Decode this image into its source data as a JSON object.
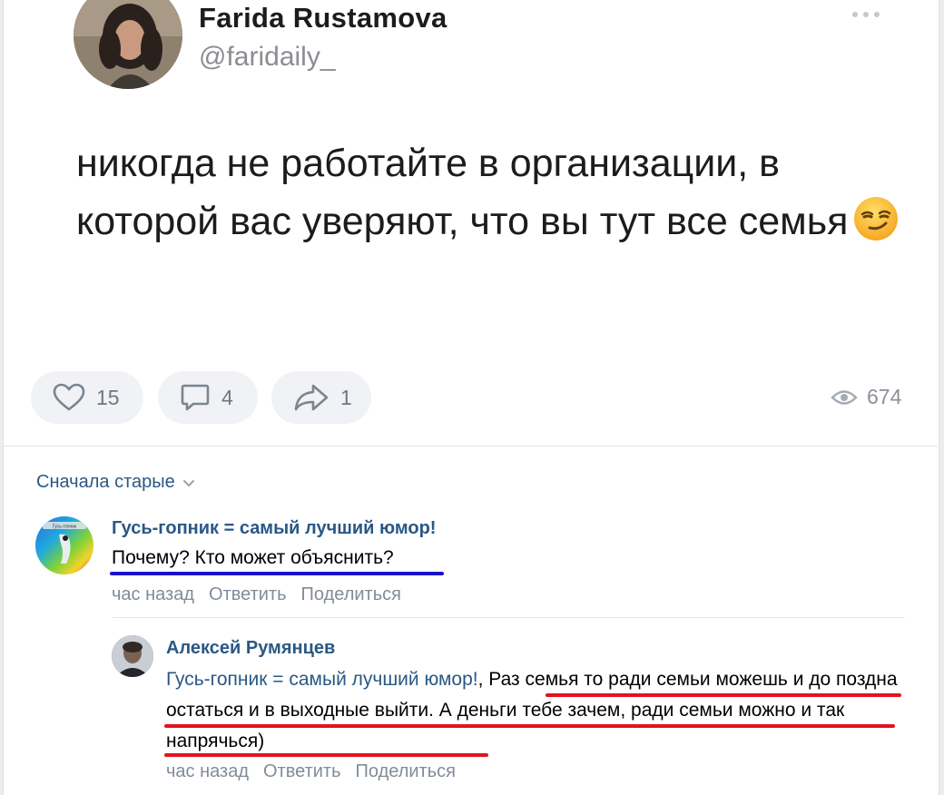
{
  "post": {
    "author_name": "Farida Rustamova",
    "author_handle": "@faridaily_",
    "text": "никогда не работайте в организации, в которой вас уверяют, что вы тут все семья",
    "emoji_icon": "smirking-face-emoji",
    "likes": "15",
    "comments": "4",
    "shares": "1",
    "views": "674"
  },
  "comments_section": {
    "sort_label": "Сначала старые"
  },
  "comments": [
    {
      "author": "Гусь-гопник = самый лучший юмор!",
      "text": "Почему? Кто может объяснить?",
      "time": "час назад",
      "reply_label": "Ответить",
      "share_label": "Поделиться",
      "avatar_text": "Гусь-гопник"
    },
    {
      "author": "Алексей Румянцев",
      "reply_to": "Гусь-гопник = самый лучший юмор!",
      "reply_sep": ", ",
      "text": "Раз семья то ради семьи можешь и до поздна остаться и в выходные выйти. А деньги тебе зачем, ради семьи можно и так напрячься)",
      "time": "час назад",
      "reply_label": "Ответить",
      "share_label": "Поделиться"
    }
  ],
  "colors": {
    "link": "#2a5885",
    "underline_blue": "#1a12c8",
    "underline_red": "#e2131f",
    "action_bg": "#f0f2f5"
  }
}
